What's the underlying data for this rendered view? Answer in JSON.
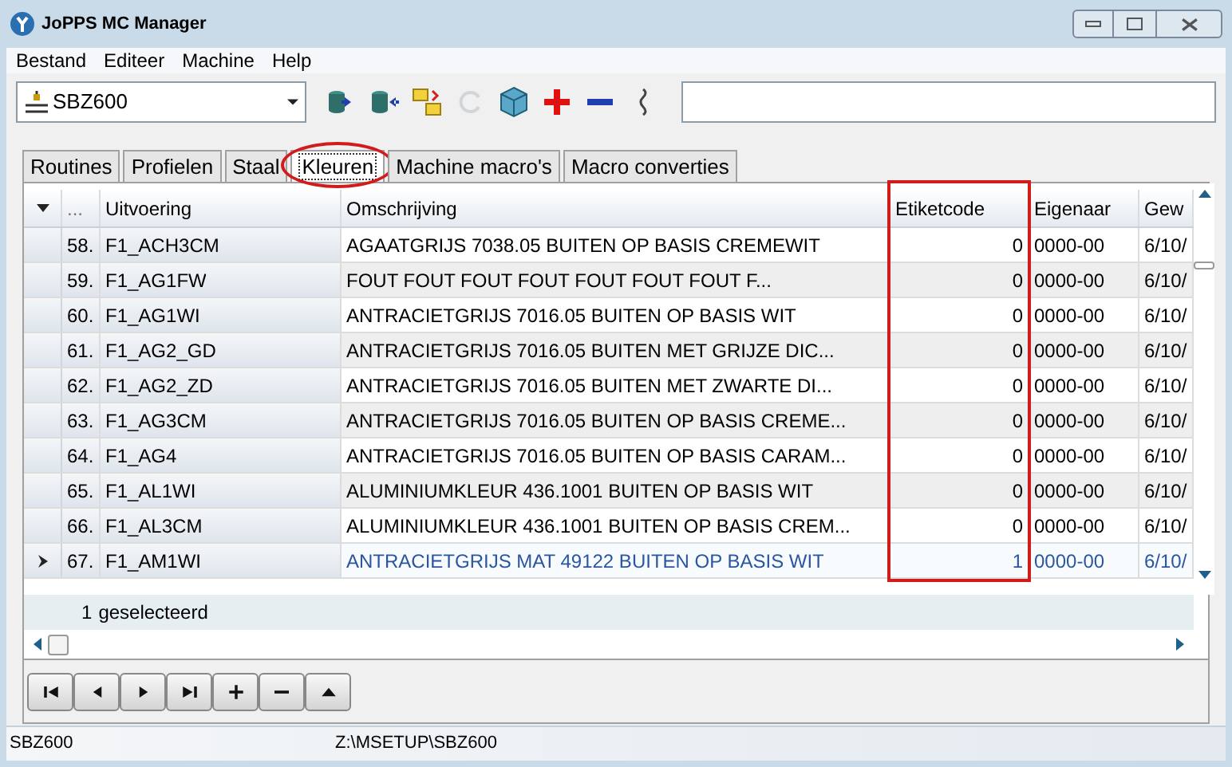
{
  "window": {
    "title": "JoPPS MC Manager"
  },
  "menu": [
    "Bestand",
    "Editeer",
    "Machine",
    "Help"
  ],
  "machine_select": {
    "value": "SBZ600"
  },
  "toolbar": [
    {
      "kind": "db-export",
      "disabled": false
    },
    {
      "kind": "db-import",
      "disabled": false
    },
    {
      "kind": "folders",
      "disabled": false
    },
    {
      "kind": "refresh",
      "disabled": true
    },
    {
      "kind": "cube",
      "disabled": false
    },
    {
      "kind": "add",
      "disabled": false
    },
    {
      "kind": "remove",
      "disabled": false
    },
    {
      "kind": "link",
      "disabled": false
    }
  ],
  "tabs": [
    {
      "label": "Routines",
      "selected": false,
      "highlighted": false
    },
    {
      "label": "Profielen",
      "selected": false,
      "highlighted": false
    },
    {
      "label": "Staal",
      "selected": false,
      "highlighted": false
    },
    {
      "label": "Kleuren",
      "selected": true,
      "highlighted": true
    },
    {
      "label": "Machine macro's",
      "selected": false,
      "highlighted": false
    },
    {
      "label": "Macro converties",
      "selected": false,
      "highlighted": false
    }
  ],
  "table": {
    "columns": [
      {
        "label": "...",
        "kind": "text",
        "highlighted": false
      },
      {
        "label": "Uitvoering",
        "kind": "text",
        "highlighted": false
      },
      {
        "label": "Omschrijving",
        "kind": "text",
        "highlighted": false
      },
      {
        "label": "Etiketcode",
        "kind": "number",
        "highlighted": true
      },
      {
        "label": "Eigenaar",
        "kind": "text",
        "highlighted": false
      },
      {
        "label": "Gew",
        "kind": "text",
        "highlighted": false
      }
    ],
    "rows": [
      {
        "selected": false,
        "cells": [
          "58.",
          "F1_ACH3CM",
          "AGAATGRIJS 7038.05 BUITEN OP BASIS CREMEWIT",
          "0",
          "0000-00",
          "6/10/"
        ]
      },
      {
        "selected": false,
        "cells": [
          "59.",
          "F1_AG1FW",
          "FOUT FOUT FOUT FOUT FOUT FOUT FOUT F...",
          "0",
          "0000-00",
          "6/10/"
        ]
      },
      {
        "selected": false,
        "cells": [
          "60.",
          "F1_AG1WI",
          "ANTRACIETGRIJS 7016.05 BUITEN OP BASIS WIT",
          "0",
          "0000-00",
          "6/10/"
        ]
      },
      {
        "selected": false,
        "cells": [
          "61.",
          "F1_AG2_GD",
          "ANTRACIETGRIJS 7016.05 BUITEN  MET GRIJZE DIC...",
          "0",
          "0000-00",
          "6/10/"
        ]
      },
      {
        "selected": false,
        "cells": [
          "62.",
          "F1_AG2_ZD",
          "ANTRACIETGRIJS 7016.05 BUITEN  MET ZWARTE DI...",
          "0",
          "0000-00",
          "6/10/"
        ]
      },
      {
        "selected": false,
        "cells": [
          "63.",
          "F1_AG3CM",
          "ANTRACIETGRIJS 7016.05 BUITEN OP BASIS CREME...",
          "0",
          "0000-00",
          "6/10/"
        ]
      },
      {
        "selected": false,
        "cells": [
          "64.",
          "F1_AG4",
          "ANTRACIETGRIJS 7016.05 BUITEN OP BASIS CARAM...",
          "0",
          "0000-00",
          "6/10/"
        ]
      },
      {
        "selected": false,
        "cells": [
          "65.",
          "F1_AL1WI",
          "ALUMINIUMKLEUR 436.1001 BUITEN OP BASIS WIT",
          "0",
          "0000-00",
          "6/10/"
        ]
      },
      {
        "selected": false,
        "cells": [
          "66.",
          "F1_AL3CM",
          "ALUMINIUMKLEUR 436.1001 BUITEN OP BASIS CREM...",
          "0",
          "0000-00",
          "6/10/"
        ]
      },
      {
        "selected": true,
        "cells": [
          "67.",
          "F1_AM1WI",
          "ANTRACIETGRIJS MAT 49122 BUITEN OP BASIS WIT",
          "1",
          "0000-00",
          "6/10/"
        ]
      }
    ],
    "footer": {
      "count": "1",
      "label": "geselecteerd"
    }
  },
  "navigator": [
    {
      "kind": "first"
    },
    {
      "kind": "prev"
    },
    {
      "kind": "next"
    },
    {
      "kind": "last"
    },
    {
      "kind": "add"
    },
    {
      "kind": "delete"
    },
    {
      "kind": "up"
    }
  ],
  "status_bar": [
    "SBZ600",
    "Z:\\MSETUP\\SBZ600"
  ]
}
